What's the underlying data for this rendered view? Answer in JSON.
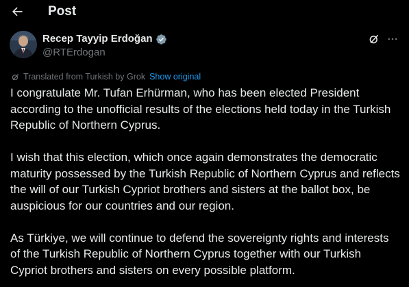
{
  "header": {
    "title": "Post",
    "back_icon": "arrow-left-icon"
  },
  "author": {
    "display_name": "Recep Tayyip Erdoğan",
    "handle": "@RTErdogan",
    "verified_icon": "verified-badge-icon",
    "verified_color": "#829aab"
  },
  "actions": {
    "grok_icon": "grok-icon",
    "more_icon": "more-horizontal-icon"
  },
  "translation": {
    "note": "Translated from Turkish by Grok",
    "show_original": "Show original",
    "link_color": "#1d9bf0"
  },
  "post": {
    "paragraphs": [
      "I congratulate Mr. Tufan Erhürman, who has been elected President according to the unofficial results of the elections held today in the Turkish Republic of Northern Cyprus.",
      "I wish that this election, which once again demonstrates the democratic maturity possessed by the Turkish Republic of Northern Cyprus and reflects the will of our Turkish Cypriot brothers and sisters at the ballot box, be auspicious for our countries and our region.",
      "As Türkiye, we will continue to defend the sovereignty rights and interests of the Turkish Republic of Northern Cyprus together with our Turkish Cypriot brothers and sisters on every possible platform."
    ]
  }
}
